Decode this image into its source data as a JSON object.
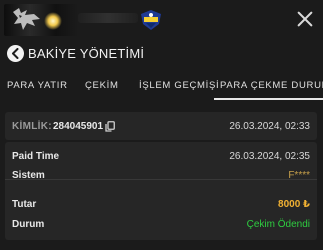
{
  "header": {
    "close_icon": "close-icon",
    "logo_icon": "wolf-logo-icon",
    "badge_icon": "shield-badge-icon"
  },
  "page": {
    "title": "BAKİYE YÖNETİMİ",
    "back_icon": "chevron-left-icon"
  },
  "tabs": [
    {
      "label": "PARA YATIR"
    },
    {
      "label": "ÇEKİM"
    },
    {
      "label": "İŞLEM GEÇMİŞİ"
    },
    {
      "label": "PARA ÇEKME DURUMU",
      "active": true
    }
  ],
  "record": {
    "id_label": "KİMLİK:",
    "id_value": "284045901",
    "created": "26.03.2024, 02:33",
    "paid_time_label": "Paid Time",
    "paid_time_value": "26.03.2024, 02:35",
    "system_label": "Sistem",
    "system_value": "F****",
    "amount_label": "Tutar",
    "amount_value": "8000 ₺",
    "status_label": "Durum",
    "status_value": "Çekim Ödendi"
  },
  "colors": {
    "background": "#1b1b1b",
    "card": "#262626",
    "system_value": "#c7a14b",
    "amount_value": "#f2b233",
    "status_value": "#2ecc40"
  }
}
